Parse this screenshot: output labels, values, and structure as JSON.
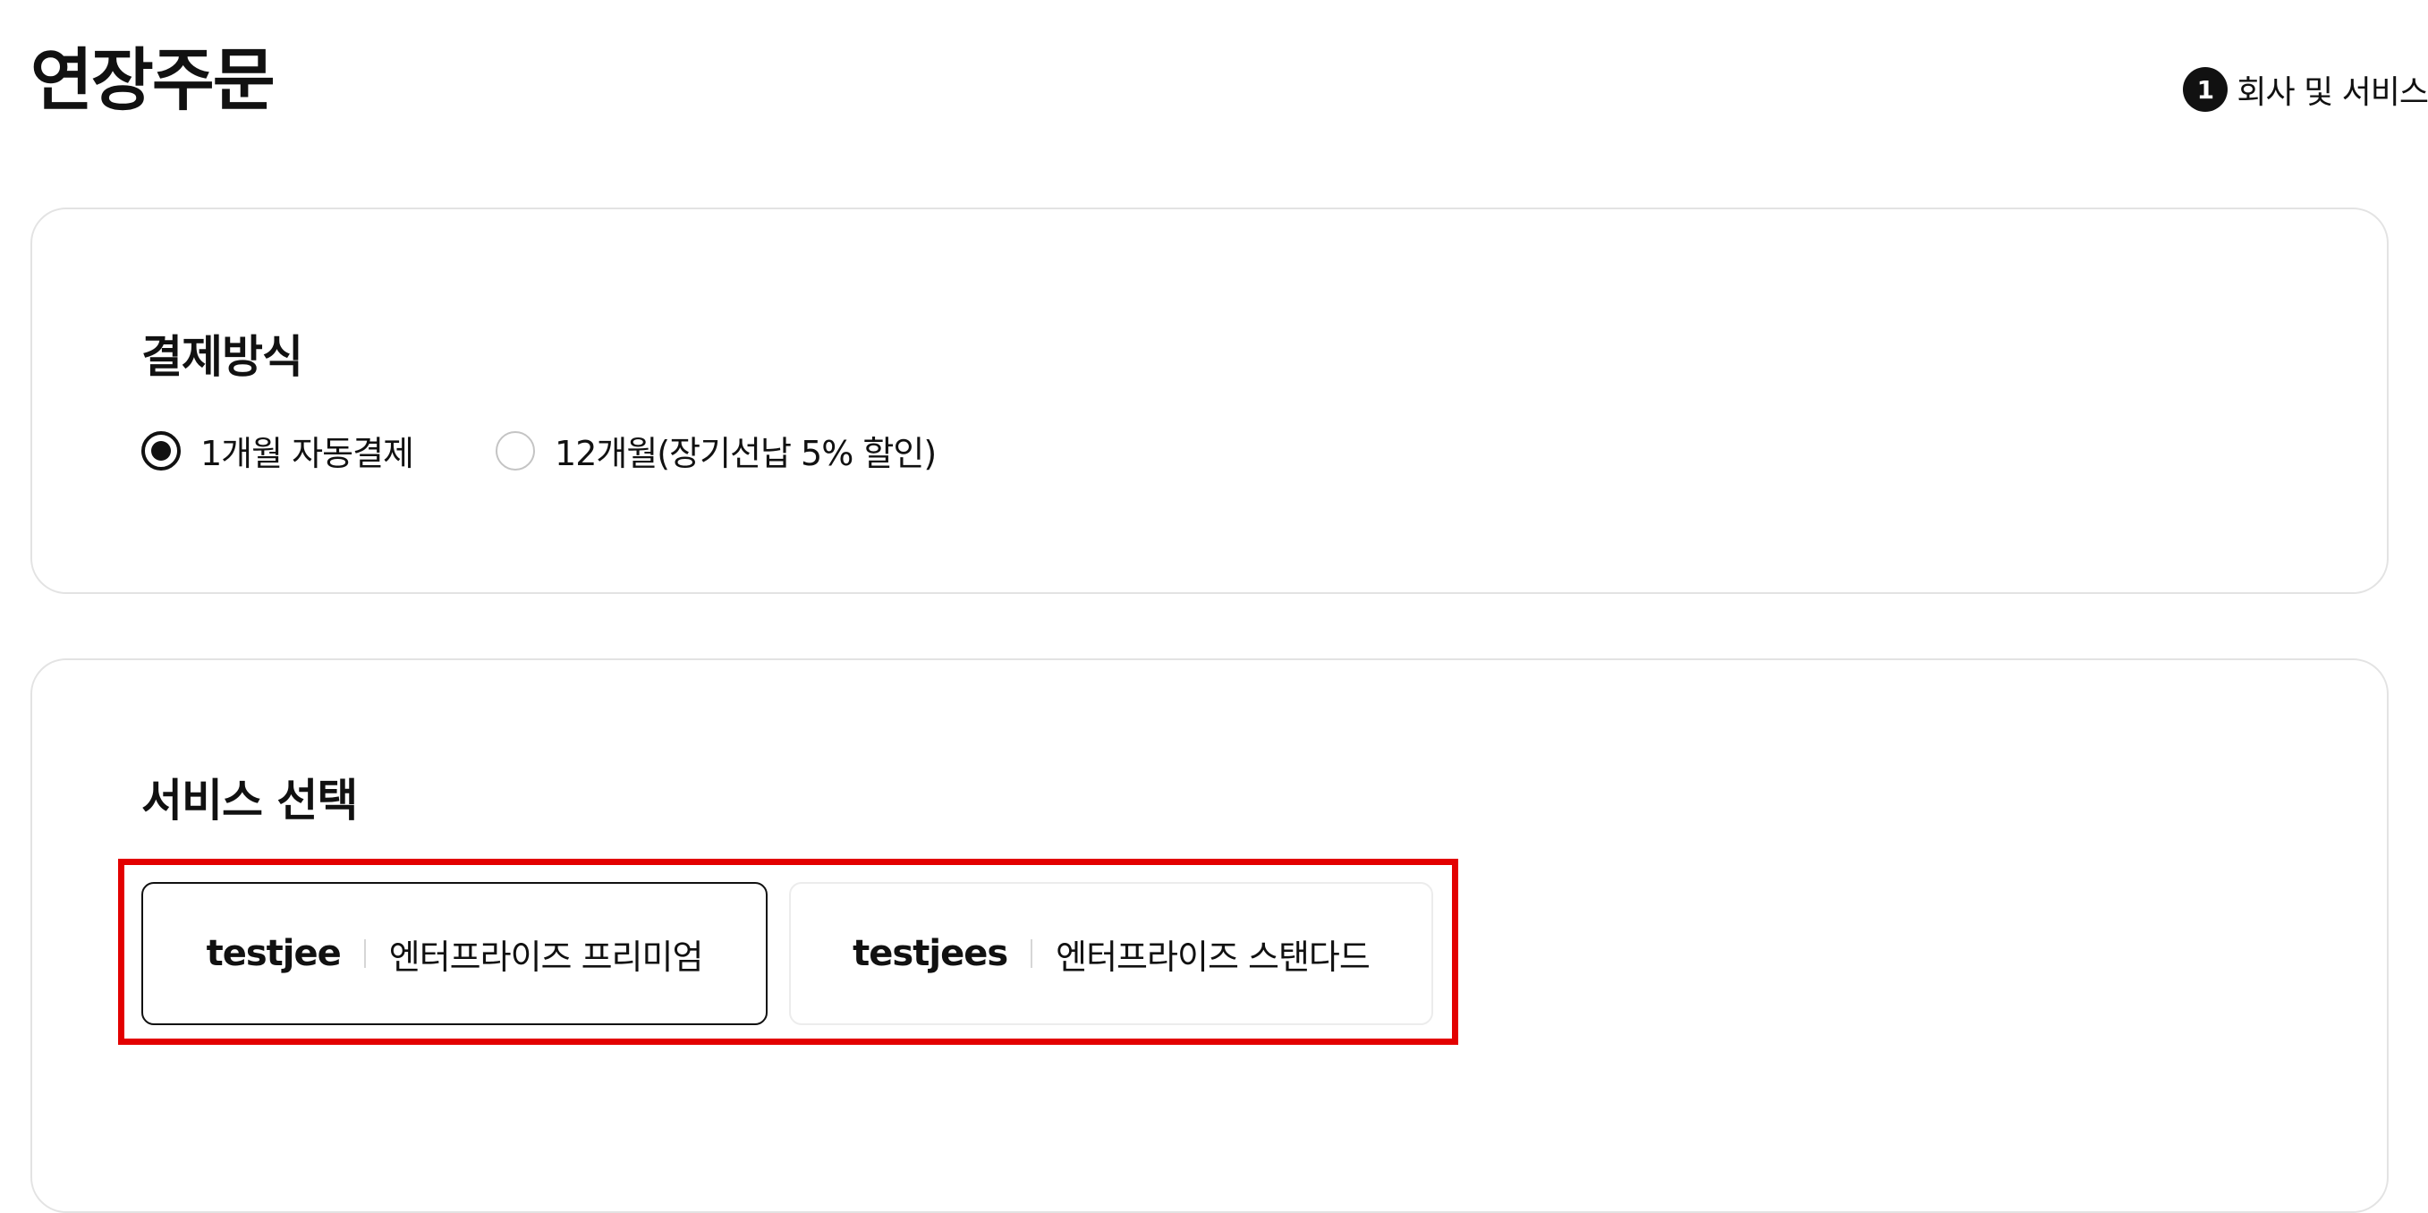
{
  "page": {
    "title": "연장주문"
  },
  "stepper": {
    "step_number": "1",
    "step_label": "회사 및 서비스"
  },
  "payment": {
    "title": "결제방식",
    "options": [
      {
        "label": "1개월 자동결제",
        "selected": true
      },
      {
        "label": "12개월(장기선납 5% 할인)",
        "selected": false
      }
    ]
  },
  "service": {
    "title": "서비스 선택",
    "items": [
      {
        "id": "testjee",
        "plan": "엔터프라이즈 프리미엄",
        "selected": true
      },
      {
        "id": "testjees",
        "plan": "엔터프라이즈 스탠다드",
        "selected": false
      }
    ]
  },
  "colors": {
    "highlight": "#e30000",
    "text": "#111111",
    "border": "#e3e3e3"
  }
}
